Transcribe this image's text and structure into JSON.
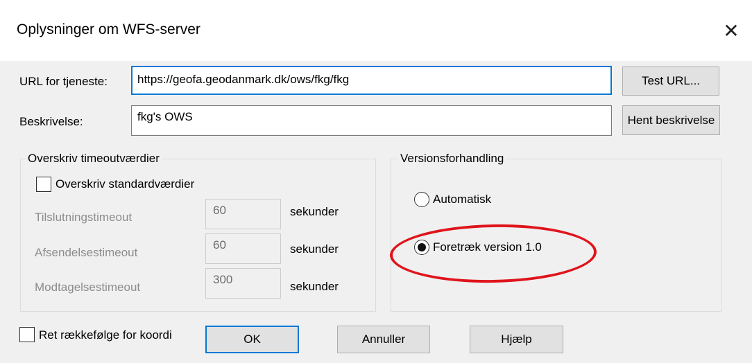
{
  "dialog": {
    "title": "Oplysninger om WFS-server",
    "close_glyph": "✕"
  },
  "url": {
    "label": "URL for tjeneste:",
    "value": "https://geofa.geodanmark.dk/ows/fkg/fkg",
    "test_button": "Test URL..."
  },
  "description": {
    "label": "Beskrivelse:",
    "value": "fkg's OWS",
    "fetch_button": "Hent beskrivelse"
  },
  "timeouts": {
    "group_title": "Overskriv timeoutværdier",
    "override_checkbox_label": "Overskriv standardværdier",
    "override_checked": false,
    "rows": [
      {
        "label": "Tilslutningstimeout",
        "value": "60",
        "unit": "sekunder"
      },
      {
        "label": "Afsendelsestimeout",
        "value": "60",
        "unit": "sekunder"
      },
      {
        "label": "Modtagelsestimeout",
        "value": "300",
        "unit": "sekunder"
      }
    ]
  },
  "version": {
    "group_title": "Versionsforhandling",
    "options": [
      {
        "label": "Automatisk",
        "selected": false
      },
      {
        "label": "Foretræk version 1.0",
        "selected": true
      }
    ],
    "highlight_color": "#e0141b"
  },
  "footer": {
    "axis_order_label": "Ret rækkefølge for koordi",
    "axis_order_checked": false,
    "ok": "OK",
    "cancel": "Annuller",
    "help": "Hjælp"
  },
  "colors": {
    "accent": "#0078d7",
    "window_bg": "#f0f0f0"
  }
}
